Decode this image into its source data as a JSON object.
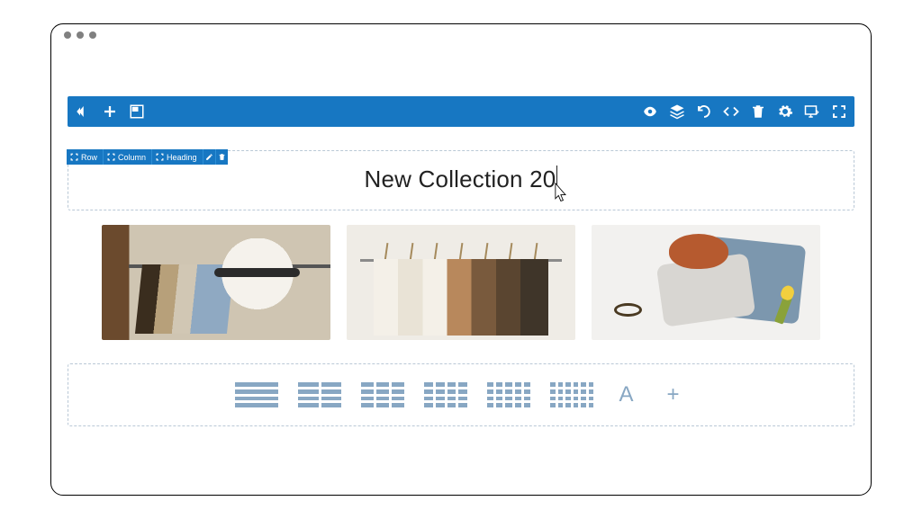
{
  "toolbar": {
    "left_icons": [
      "logo",
      "add",
      "template"
    ],
    "right_icons": [
      "preview",
      "layers",
      "undo",
      "code",
      "trash",
      "settings",
      "devices",
      "fullscreen"
    ]
  },
  "breadcrumb": {
    "items": [
      "Row",
      "Column",
      "Heading"
    ],
    "actions": [
      "edit",
      "delete"
    ]
  },
  "heading": {
    "value": "New Collection 20"
  },
  "images": [
    "clothes-rack-hat",
    "hangers-neutrals",
    "flatlay-knitwear"
  ],
  "column_layouts": [
    {
      "cols": 1,
      "rows": 4
    },
    {
      "cols": 2,
      "rows": 4
    },
    {
      "cols": 3,
      "rows": 4
    },
    {
      "cols": 4,
      "rows": 4
    },
    {
      "cols": 5,
      "rows": 4
    },
    {
      "cols": 6,
      "rows": 4
    }
  ],
  "extra_options": {
    "text_label": "A",
    "more": "+"
  }
}
